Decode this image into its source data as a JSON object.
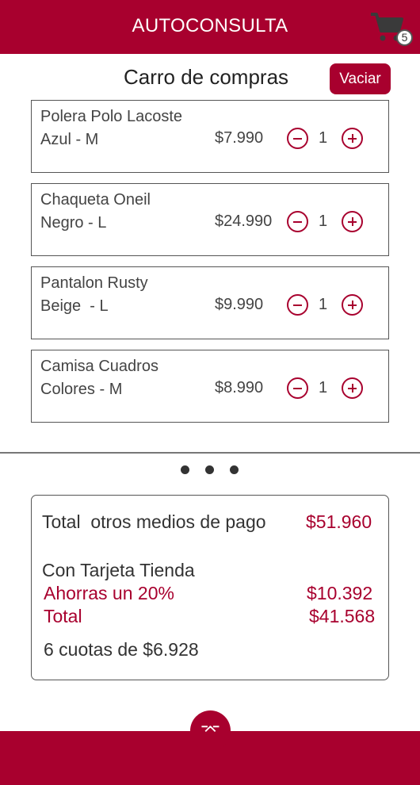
{
  "header": {
    "title": "AUTOCONSULTA",
    "cart_icon": "shopping-cart-icon",
    "cart_count": "5"
  },
  "cart": {
    "title": "Carro de compras",
    "clear_label": "Vaciar",
    "items": [
      {
        "name": "Polera Polo Lacoste",
        "variant": "Azul - M",
        "price": "$7.990",
        "qty": "1"
      },
      {
        "name": "Chaqueta Oneil",
        "variant": "Negro - L",
        "price": "$24.990",
        "qty": "1"
      },
      {
        "name": "Pantalon Rusty",
        "variant": "Beige  - L",
        "price": "$9.990",
        "qty": "1"
      },
      {
        "name": "Camisa Cuadros",
        "variant": "Colores - M",
        "price": "$8.990",
        "qty": "1"
      }
    ]
  },
  "pager": {
    "dot_count": 3
  },
  "summary": {
    "other_payment_label": "Total  otros medios de pago",
    "other_payment_total": "$51.960",
    "store_card_label": "Con Tarjeta Tienda",
    "savings_label": "Ahorras un 20%",
    "savings_value": "$10.392",
    "total_label": "Total",
    "total_value": "$41.568",
    "installments": "6 cuotas de $6.928"
  },
  "footer": {
    "collapse_icon": "chevron-down-icon"
  },
  "colors": {
    "brand": "#a8002e",
    "text": "#444444",
    "background": "#ffffff"
  }
}
